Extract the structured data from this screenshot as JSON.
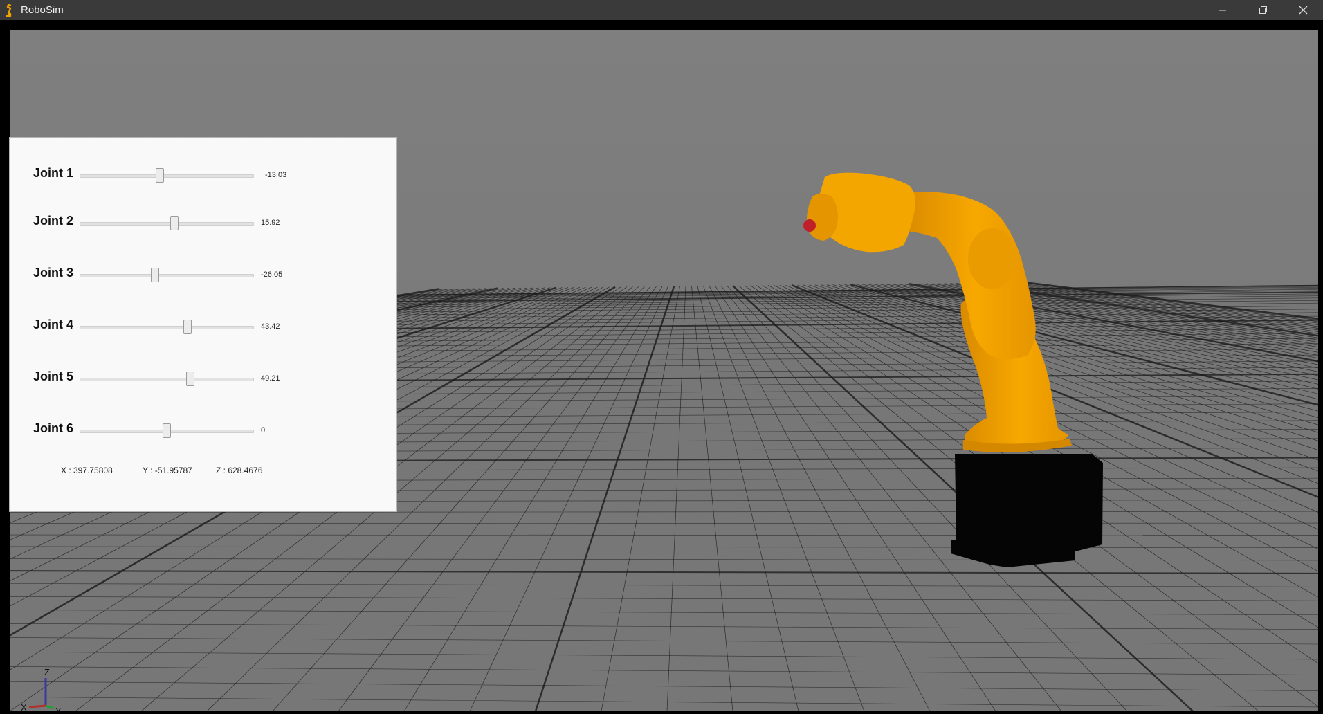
{
  "window": {
    "title": "RoboSim",
    "controls": [
      "minimize-icon",
      "restore-icon",
      "close-icon"
    ]
  },
  "joints": [
    {
      "label": "Joint 1",
      "value": "-13.03",
      "slider_fraction": 0.46
    },
    {
      "label": "Joint 2",
      "value": "15.92",
      "slider_fraction": 0.545
    },
    {
      "label": "Joint 3",
      "value": "-26.05",
      "slider_fraction": 0.43
    },
    {
      "label": "Joint 4",
      "value": "43.42",
      "slider_fraction": 0.62
    },
    {
      "label": "Joint 5",
      "value": "49.21",
      "slider_fraction": 0.635
    },
    {
      "label": "Joint 6",
      "value": "0",
      "slider_fraction": 0.5
    }
  ],
  "coordinates": {
    "x": "X : 397.75808",
    "y": "Y : -51.95787",
    "z": "Z : 628.4676"
  },
  "axis_gizmo": {
    "x": "X",
    "y": "Y",
    "z": "Z"
  },
  "colors": {
    "robot": "#f0a000",
    "robot_base": "#050505",
    "tool_tip": "#c0202a",
    "floor_grid": "#1a1a1a"
  }
}
